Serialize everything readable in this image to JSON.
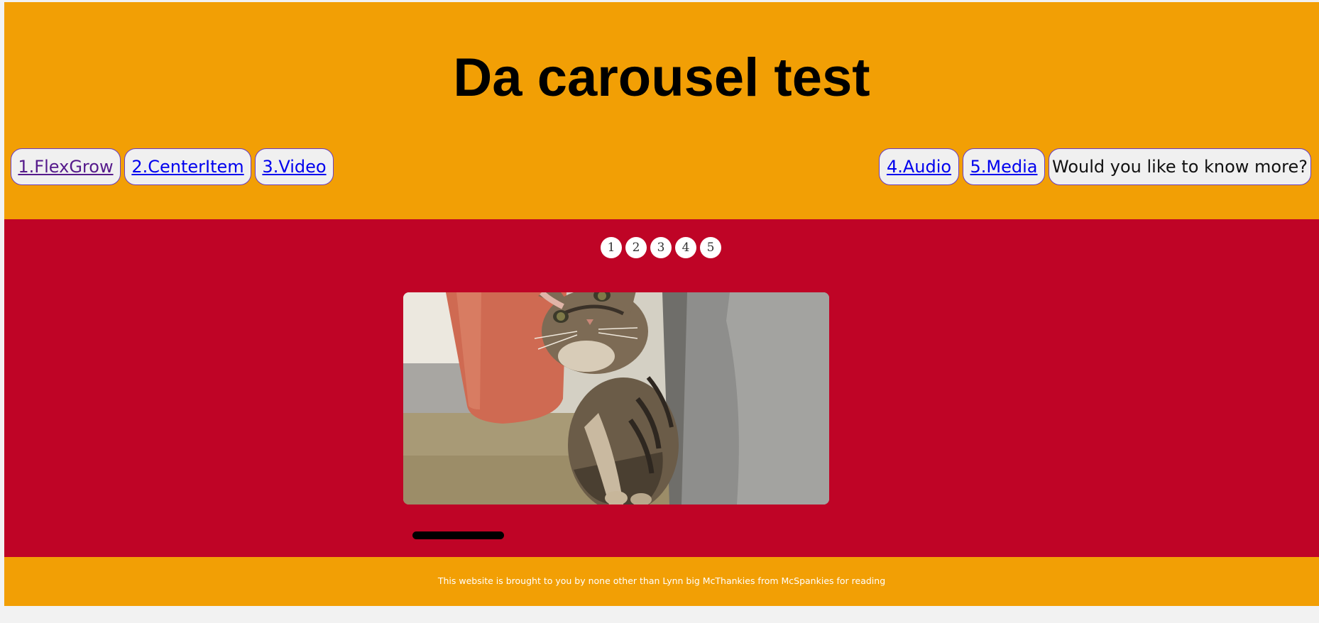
{
  "header": {
    "title": "Da carousel test",
    "nav_left": [
      {
        "label": "1.FlexGrow"
      },
      {
        "label": "2.CenterItem"
      },
      {
        "label": "3.Video"
      }
    ],
    "nav_right": [
      {
        "label": "4.Audio"
      },
      {
        "label": "5.Media"
      },
      {
        "label": "Would you like to know more?"
      }
    ]
  },
  "carousel": {
    "dots": [
      "1",
      "2",
      "3",
      "4",
      "5"
    ],
    "progress": 0.2
  },
  "footer": {
    "text": "This website is brought to you by none other than Lynn big McThankies from McSpankies for reading"
  },
  "colors": {
    "header_bg": "#f29f05",
    "main_bg": "#bf0426",
    "footer_bg": "#f29f05"
  }
}
